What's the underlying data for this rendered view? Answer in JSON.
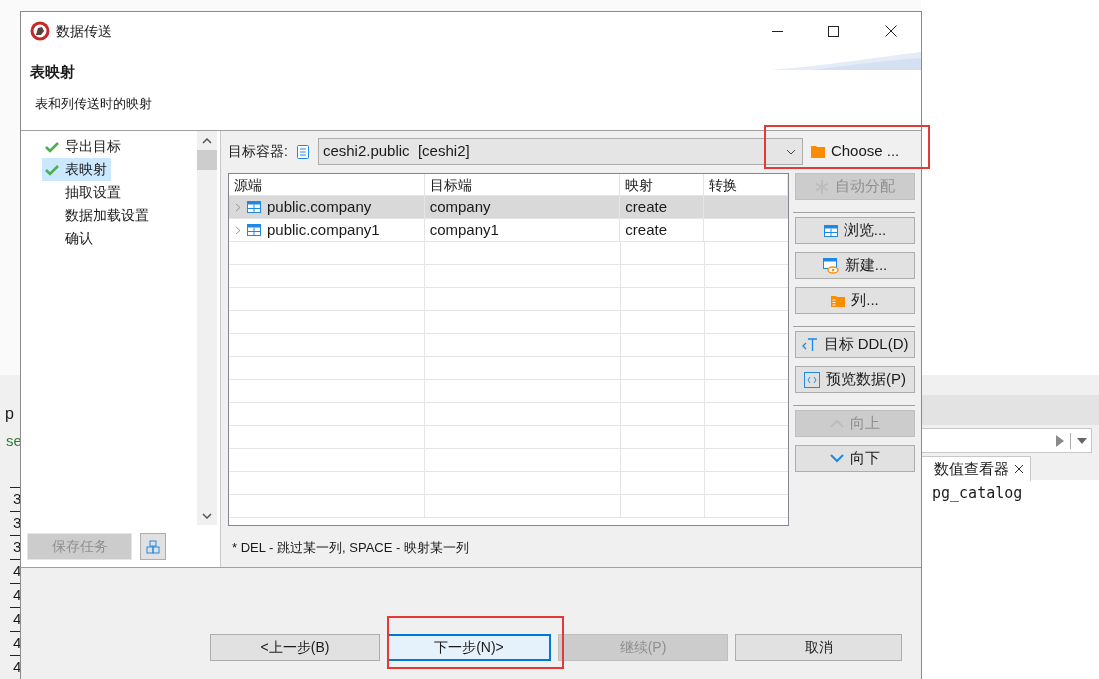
{
  "window": {
    "title": "数据传送"
  },
  "header": {
    "title": "表映射",
    "subtitle": "表和列传送时的映射"
  },
  "steps": [
    {
      "label": "导出目标",
      "done": true,
      "selected": false
    },
    {
      "label": "表映射",
      "done": true,
      "selected": true
    },
    {
      "label": "抽取设置",
      "done": false,
      "selected": false
    },
    {
      "label": "数据加载设置",
      "done": false,
      "selected": false
    },
    {
      "label": "确认",
      "done": false,
      "selected": false
    }
  ],
  "save_task": {
    "label": "保存任务",
    "disabled": true
  },
  "target_container": {
    "label": "目标容器:",
    "value": "ceshi2.public  [ceshi2]",
    "choose": "Choose ..."
  },
  "table": {
    "columns": [
      "源端",
      "目标端",
      "映射",
      "转换"
    ],
    "rows": [
      {
        "source": "public.company",
        "target": "company",
        "mapping": "create",
        "selected": true
      },
      {
        "source": "public.company1",
        "target": "company1",
        "mapping": "create",
        "selected": false
      }
    ]
  },
  "side_buttons": [
    {
      "kind": "asterisk",
      "label": "自动分配",
      "disabled": true
    },
    {
      "kind": "separator"
    },
    {
      "kind": "table",
      "label": "浏览...",
      "disabled": false
    },
    {
      "kind": "table-eye",
      "label": "新建...",
      "disabled": false
    },
    {
      "kind": "folder",
      "label": "列...",
      "disabled": false
    },
    {
      "kind": "separator"
    },
    {
      "kind": "ddl",
      "label": "目标 DDL(D)",
      "disabled": false
    },
    {
      "kind": "preview",
      "label": "预览数据(P)",
      "disabled": false
    },
    {
      "kind": "separator"
    },
    {
      "kind": "up",
      "label": "向上",
      "disabled": true
    },
    {
      "kind": "down",
      "label": "向下",
      "disabled": false
    }
  ],
  "hint": "* DEL - 跳过某一列, SPACE - 映射某一列",
  "nav_buttons": [
    {
      "label": "<上一步(B)",
      "disabled": false,
      "focused": false
    },
    {
      "label": "下一步(N)>",
      "disabled": false,
      "focused": true
    },
    {
      "label": "继续(P)",
      "disabled": true,
      "focused": false
    },
    {
      "label": "取消",
      "disabled": false,
      "focused": false
    }
  ],
  "background": {
    "tab": "p",
    "query": "se",
    "line_numbers": [
      "3",
      "3",
      "3",
      "4",
      "4",
      "4",
      "4",
      "4"
    ],
    "viewer_tab": "数值查看器",
    "viewer_text": "pg_catalog"
  }
}
